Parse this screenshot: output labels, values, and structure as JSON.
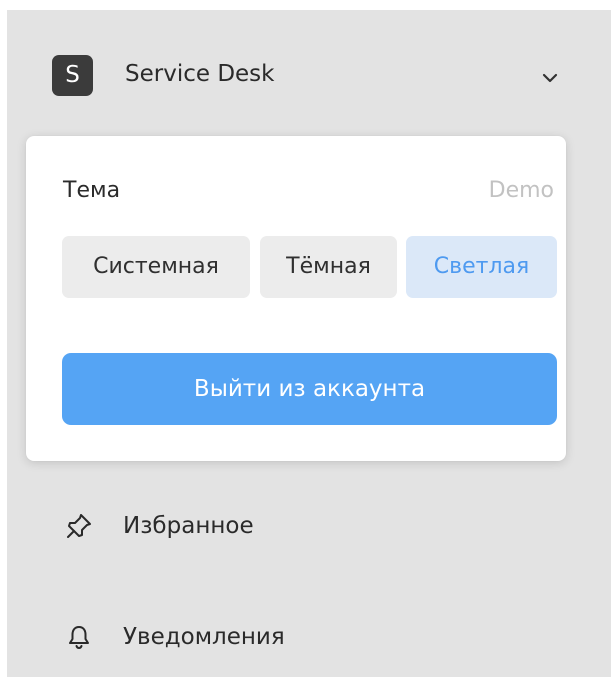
{
  "workspace": {
    "avatar_letter": "S",
    "name": "Service Desk",
    "chevron_icon": "chevron-down-icon"
  },
  "theme_popup": {
    "title": "Тема",
    "badge": "Demo",
    "options": [
      {
        "label": "Системная",
        "selected": false
      },
      {
        "label": "Тёмная",
        "selected": false
      },
      {
        "label": "Светлая",
        "selected": true
      }
    ],
    "logout_label": "Выйти из аккаунта"
  },
  "nav": {
    "items": [
      {
        "label": "Избранное",
        "icon": "pin-icon"
      },
      {
        "label": "Уведомления",
        "icon": "bell-icon"
      }
    ]
  },
  "colors": {
    "accent": "#55a4f4",
    "selected_bg": "#dbe8f8",
    "selected_text": "#4e9af0",
    "sidebar_bg": "#e3e3e3"
  }
}
